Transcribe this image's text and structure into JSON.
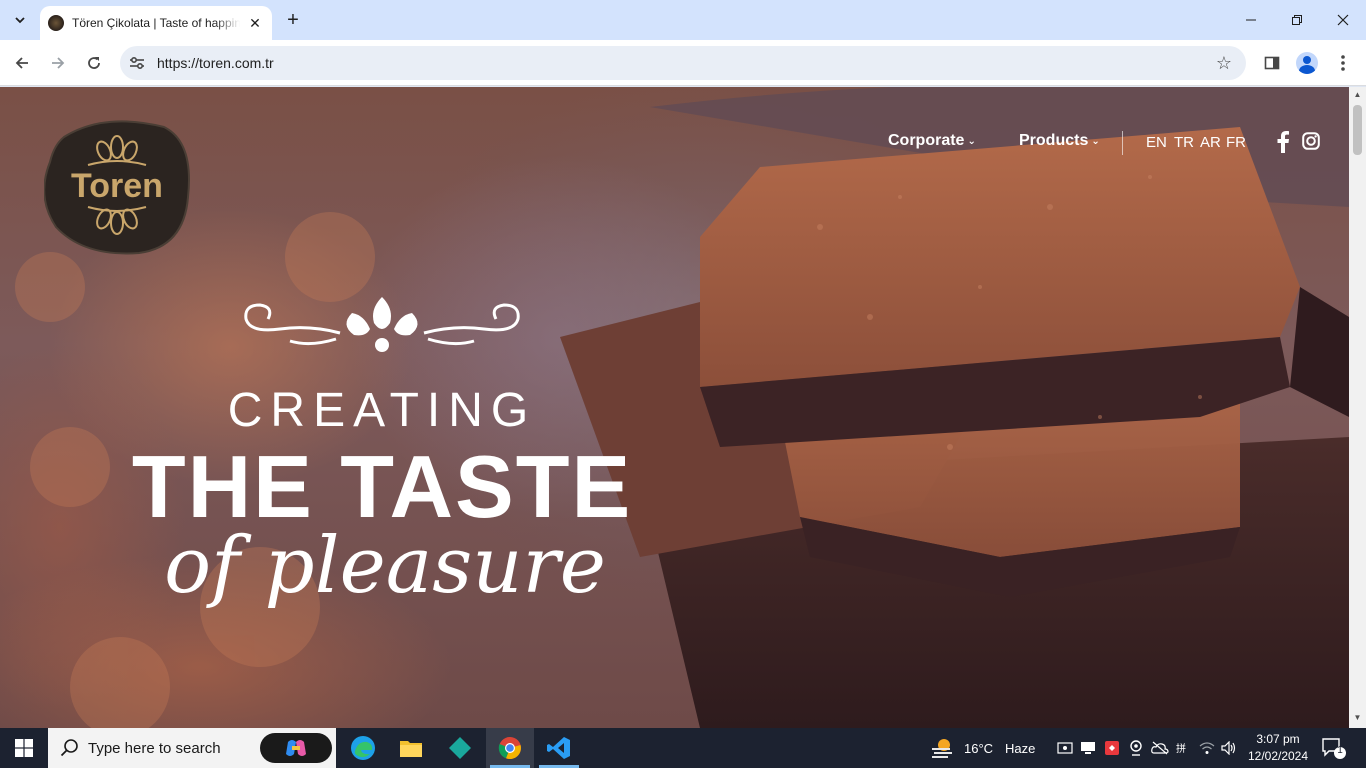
{
  "browser": {
    "tab_title": "Tören Çikolata | Taste of happiness",
    "url": "https://toren.com.tr"
  },
  "site": {
    "logo_text": "Toren",
    "nav": [
      {
        "label": "Corporate"
      },
      {
        "label": "Products"
      }
    ],
    "languages": [
      "EN",
      "TR",
      "AR",
      "FR"
    ],
    "hero": {
      "line1": "CREATING",
      "line2": "THE TASTE",
      "line3": "of pleasure"
    }
  },
  "taskbar": {
    "search_placeholder": "Type here to search",
    "weather_temp": "16°C",
    "weather_text": "Haze",
    "time": "3:07 pm",
    "date": "12/02/2024",
    "notification_count": "1"
  },
  "colors": {
    "logo_gold": "#c9a66b",
    "logo_dark": "#2b2420",
    "chrome_tabstrip": "#d3e3fd",
    "taskbar": "#1c2230"
  }
}
